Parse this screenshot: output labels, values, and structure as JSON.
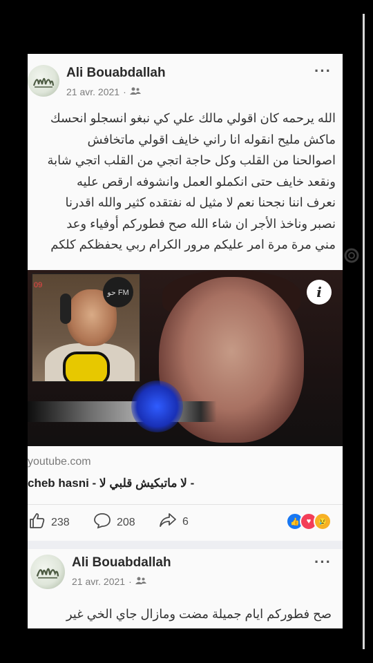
{
  "post1": {
    "author": "Ali Bouabdallah",
    "date": "21 avr. 2021",
    "more_icon": "···",
    "text_lines": [
      "الله يرحمه  كان اقولي مالك علي  كي نبغو انسجلو  انحسك",
      "ماكش مليح   انقوله انا  راني  خايف  اقولي ماتخافش",
      "اصوالحنا  من القلب  وكل حاجة اتجي من القلب اتجي شابة",
      "ونقعد خايف حتى انكملو العمل  وانشوفه  ارقص عليه",
      "نعرف اننا نجحنا  نعم لا مثيل له  نفتقده كثير  والله  اقدرنا",
      "نصبر  وناخذ الأجر  ان شاء الله  صح فطوركم أوفياء وعد",
      "مني مرة مرة  امر عليكم  مرور الكرام  ربي يحفظكم كلكم"
    ],
    "video": {
      "info_icon": "i",
      "inset_logo": "حو FM",
      "inset_number": "09"
    },
    "link": {
      "domain": "youtube.com",
      "title": "cheb hasni - لا ماتبكيش قلبي لا -"
    },
    "actions": {
      "likes": "238",
      "comments": "208",
      "shares": "6"
    },
    "reactions": [
      "like",
      "love",
      "sad"
    ]
  },
  "post2": {
    "author": "Ali Bouabdallah",
    "date": "21 avr. 2021",
    "more_icon": "···",
    "text_line": "صح فطوركم  ايام  جميلة  مضت  ومازال جاي الخي غير"
  },
  "colors": {
    "background": "#000000",
    "card": "#fafafa",
    "like": "#1877f2",
    "love": "#f33e58",
    "sad": "#f7b125"
  }
}
